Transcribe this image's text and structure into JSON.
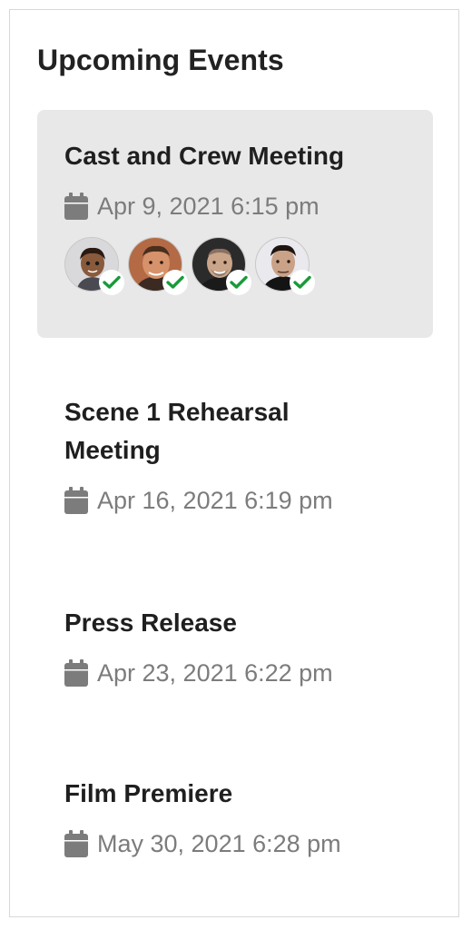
{
  "panel": {
    "title": "Upcoming Events"
  },
  "events": [
    {
      "title": "Cast and Crew Meeting",
      "date": "Apr 9, 2021 6:15 pm",
      "selected": true,
      "attendees": [
        {
          "avatar": "cartoon-avatar",
          "status": "accepted",
          "status_icon": "check-icon"
        },
        {
          "avatar": "person-photo",
          "status": "accepted",
          "status_icon": "check-icon"
        },
        {
          "avatar": "person-photo",
          "status": "accepted",
          "status_icon": "check-icon"
        },
        {
          "avatar": "person-photo",
          "status": "accepted",
          "status_icon": "check-icon"
        }
      ]
    },
    {
      "title": "Scene 1 Rehearsal Meeting",
      "date": "Apr 16, 2021 6:19 pm",
      "selected": false
    },
    {
      "title": "Press Release",
      "date": "Apr 23, 2021 6:22 pm",
      "selected": false
    },
    {
      "title": "Film Premiere",
      "date": "May 30, 2021 6:28 pm",
      "selected": false
    }
  ],
  "colors": {
    "selected_background": "#e8e8e8",
    "date_text": "#7c7c7c",
    "accepted_check": "#1a9a3a",
    "border": "#d9d9d9"
  },
  "icons": {
    "date": "calendar-icon",
    "accepted": "check-icon"
  }
}
